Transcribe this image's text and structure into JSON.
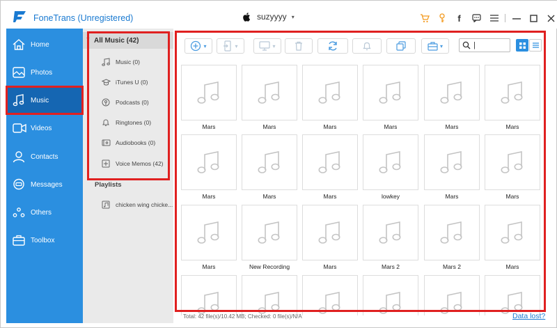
{
  "app": {
    "title": "FoneTrans (Unregistered)",
    "device_name": "suzyyyy",
    "accent_color": "#2b8fe0",
    "title_color": "#1a7ad1",
    "highlight_color": "#e02020"
  },
  "titlebar_icons": [
    "cart-icon",
    "key-icon",
    "facebook-icon",
    "feedback-icon",
    "menu-icon",
    "minimize-icon",
    "maximize-icon",
    "close-icon"
  ],
  "nav": {
    "items": [
      {
        "label": "Home",
        "icon": "home-icon"
      },
      {
        "label": "Photos",
        "icon": "photo-icon"
      },
      {
        "label": "Music",
        "icon": "music-note-icon",
        "active": true
      },
      {
        "label": "Videos",
        "icon": "video-camera-icon"
      },
      {
        "label": "Contacts",
        "icon": "contact-icon"
      },
      {
        "label": "Messages",
        "icon": "message-icon"
      },
      {
        "label": "Others",
        "icon": "others-icon"
      },
      {
        "label": "Toolbox",
        "icon": "toolbox-icon"
      }
    ]
  },
  "categories": {
    "header": "All Music (42)",
    "items": [
      {
        "label": "Music (0)",
        "icon": "music-note-icon"
      },
      {
        "label": "iTunes U (0)",
        "icon": "graduation-cap-icon"
      },
      {
        "label": "Podcasts (0)",
        "icon": "podcast-icon"
      },
      {
        "label": "Ringtones (0)",
        "icon": "bell-icon"
      },
      {
        "label": "Audiobooks (0)",
        "icon": "audiobook-icon"
      },
      {
        "label": "Voice Memos (42)",
        "icon": "voice-memo-icon"
      }
    ],
    "playlists_label": "Playlists",
    "playlist_items": [
      {
        "label": "chicken wing chicke...",
        "icon": "playlist-icon"
      }
    ]
  },
  "toolbar": {
    "buttons": [
      "add-icon",
      "export-to-device-icon",
      "export-to-pc-icon",
      "delete-icon",
      "sync-icon",
      "ringtone-icon",
      "copy-icon",
      "toolbox-icon"
    ],
    "search_placeholder": ""
  },
  "grid": {
    "items": [
      "Mars",
      "Mars",
      "Mars",
      "Mars",
      "Mars",
      "Mars",
      "Mars",
      "Mars",
      "Mars",
      "lowkey",
      "Mars",
      "Mars",
      "Mars",
      "New Recording",
      "Mars",
      "Mars 2",
      "Mars 2",
      "Mars",
      "",
      "",
      "",
      "",
      "",
      ""
    ]
  },
  "status": {
    "text": "Total: 42 file(s)/10.42 MB; Checked: 0 file(s)/N/A",
    "data_lost": "Data lost?"
  }
}
